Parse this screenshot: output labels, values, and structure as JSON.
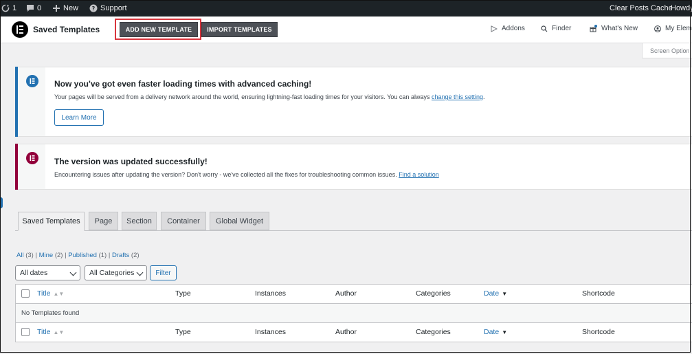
{
  "adminbar": {
    "updates_count": "1",
    "comments_count": "0",
    "new_label": "New",
    "support_label": "Support",
    "clear_cache_label": "Clear Posts Cache",
    "howdy_label": "Howdy"
  },
  "topbar": {
    "title": "Saved Templates",
    "add_new_label": "ADD NEW TEMPLATE",
    "import_label": "IMPORT TEMPLATES",
    "addons_label": "Addons",
    "finder_label": "Finder",
    "whats_new_label": "What's New",
    "my_elementor_label": "My Elem",
    "highlight_color": "#d9363e"
  },
  "screen_options_label": "Screen Option",
  "notices": [
    {
      "title": "Now you've got even faster loading times with advanced caching!",
      "text": "Your pages will be served from a delivery network around the world, ensuring lightning-fast loading times for your visitors. You can always",
      "link": "change this setting",
      "link_suffix": ".",
      "button": "Learn More",
      "accent": "#2271b1"
    },
    {
      "title": "The version was updated successfully!",
      "text": "Encountering issues after updating the version? Don't worry - we've collected all the fixes for troubleshooting common issues.",
      "link": "Find a solution",
      "accent": "#92003b"
    }
  ],
  "tabs": [
    {
      "label": "Saved Templates",
      "active": true
    },
    {
      "label": "Page",
      "active": false
    },
    {
      "label": "Section",
      "active": false
    },
    {
      "label": "Container",
      "active": false
    },
    {
      "label": "Global Widget",
      "active": false
    }
  ],
  "views": {
    "all": "All",
    "all_count": "(3)",
    "mine": "Mine",
    "mine_count": "(2)",
    "published": "Published",
    "published_count": "(1)",
    "drafts": "Drafts",
    "drafts_count": "(2)",
    "separator": "|"
  },
  "filters": {
    "dates_selected": "All dates",
    "categories_selected": "All Categories",
    "filter_button": "Filter"
  },
  "table": {
    "columns": [
      "Title",
      "Type",
      "Instances",
      "Author",
      "Categories",
      "Date",
      "Shortcode"
    ],
    "empty_message": "No Templates found"
  }
}
